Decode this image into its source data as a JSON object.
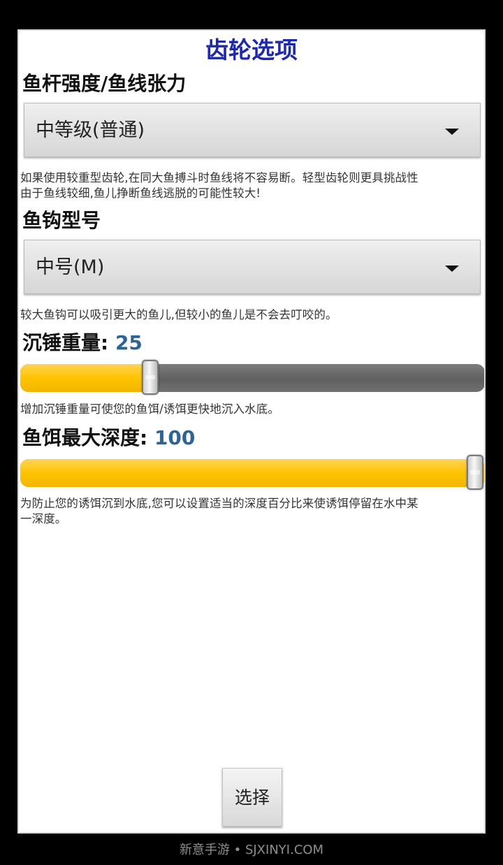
{
  "title": "齿轮选项",
  "rod": {
    "label": "鱼杆强度/鱼线张力",
    "selected": "中等级(普通)",
    "help_line1": "如果使用较重型齿轮,在同大鱼搏斗时鱼线将不容易断。轻型齿轮则更具挑战性",
    "help_line2": "由于鱼线较细,鱼儿挣断鱼线逃脱的可能性较大!"
  },
  "hook": {
    "label": "鱼钩型号",
    "selected": "中号(M)",
    "help": "较大鱼钩可以吸引更大的鱼儿,但较小的鱼儿是不会去叮咬的。"
  },
  "sinker": {
    "label": "沉锤重量: ",
    "value": "25",
    "fill_fraction": 0.27,
    "help": "增加沉锤重量可使您的鱼饵/诱饵更快地沉入水底。"
  },
  "depth": {
    "label": "鱼饵最大深度: ",
    "value": "100",
    "fill_fraction": 1.0,
    "help_line1": "为防止您的诱饵沉到水底,您可以设置适当的深度百分比来使诱饵停留在水中某",
    "help_line2": "一深度。"
  },
  "select_button": "选择",
  "watermark": "新意手游 • SJXINYI.COM",
  "colors": {
    "title": "#1d29a7",
    "value": "#2d6496",
    "slider_fill": "#ffc400",
    "slider_track": "#666666"
  }
}
